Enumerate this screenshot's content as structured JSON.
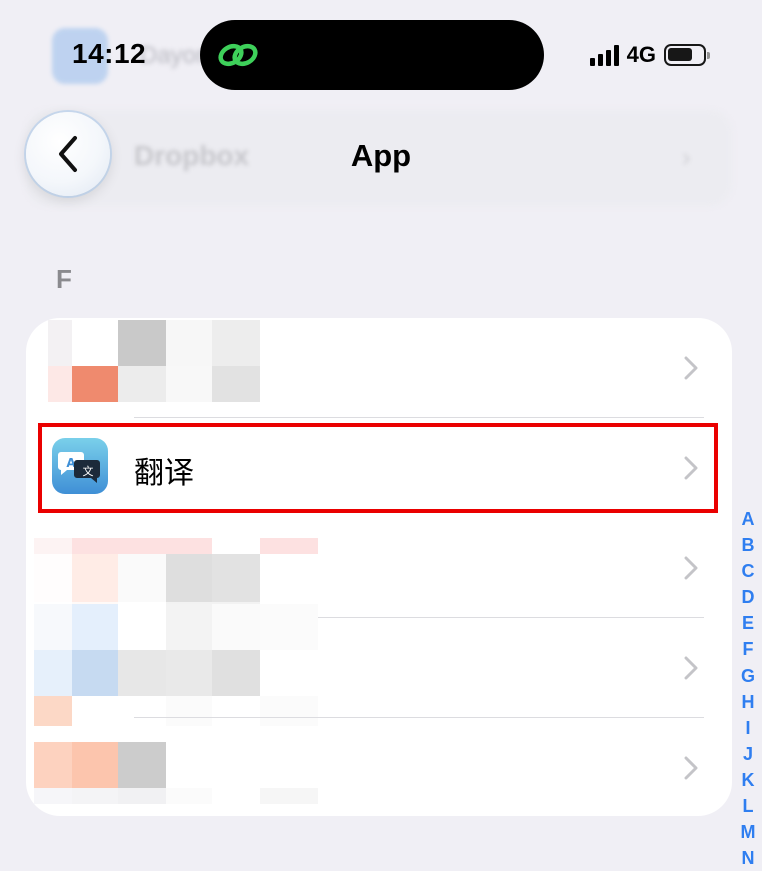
{
  "status": {
    "time": "14:12",
    "network": "4G"
  },
  "background": {
    "prev_app_label": "Dropbox",
    "prev_top_label": "Dayone"
  },
  "nav": {
    "title": "App"
  },
  "section": {
    "header": "F"
  },
  "list": {
    "rows": [
      {
        "label": ""
      },
      {
        "label": "翻译"
      },
      {
        "label": ""
      },
      {
        "label": ""
      },
      {
        "label": ""
      }
    ]
  },
  "index": [
    "A",
    "B",
    "C",
    "D",
    "E",
    "F",
    "G",
    "H",
    "I",
    "J",
    "K",
    "L",
    "M",
    "N"
  ],
  "colors": {
    "accent": "#2f7ef0",
    "highlight": "#ea0000",
    "background": "#f0eff5"
  },
  "icons": {
    "back": "chevron-left-icon",
    "chevron": "chevron-right-icon",
    "translate": "translate-app-icon"
  }
}
